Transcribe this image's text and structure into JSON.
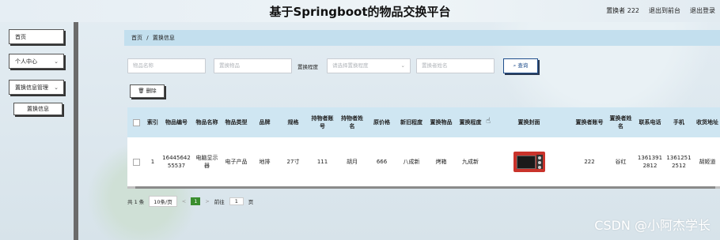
{
  "header": {
    "title": "基于Springboot的物品交换平台",
    "user": "置换者 222",
    "back_to_front": "退出到前台",
    "logout": "退出登录"
  },
  "sidebar": {
    "items": [
      {
        "label": "首页"
      },
      {
        "label": "个人中心"
      },
      {
        "label": "置换信息管理"
      }
    ],
    "sub_item": "置换信息"
  },
  "breadcrumb": {
    "home": "首页",
    "sep": "/",
    "current": "置换信息"
  },
  "filters": {
    "item_name_placeholder": "物品名称",
    "exchange_item_placeholder": "置换物品",
    "exchange_degree_label": "置换程度",
    "exchange_degree_placeholder": "请选择置换程度",
    "exchanger_name_placeholder": "置换者姓名",
    "query_label": "查询"
  },
  "delete_label": "删除",
  "table": {
    "headers": {
      "index": "索引",
      "item_no": "物品编号",
      "item_name": "物品名称",
      "item_type": "物品类型",
      "brand": "品牌",
      "spec": "规格",
      "holder_account": "持物者账号",
      "holder_name": "持物者姓名",
      "original_price": "原价格",
      "condition": "新旧程度",
      "exchange_item": "置换物品",
      "exchange_degree": "置换程度",
      "cover": "置换封面",
      "exchanger_account": "置换者账号",
      "exchanger_name": "置换者姓名",
      "contact_phone": "联系电话",
      "mobile": "手机",
      "address": "收货地址"
    },
    "row": {
      "index": "1",
      "item_no": "1644564255537",
      "item_name": "电脑显示器",
      "item_type": "电子产品",
      "brand": "地排",
      "spec": "27寸",
      "holder_account": "111",
      "holder_name": "胡月",
      "original_price": "666",
      "condition": "八成新",
      "exchange_item": "烤箱",
      "exchange_degree": "九成新",
      "exchanger_account": "222",
      "exchanger_name": "谷红",
      "contact_phone": "13613912812",
      "mobile": "13612512512",
      "address": "胡姬道"
    }
  },
  "pager": {
    "total": "共 1 条",
    "page_size": "10条/页",
    "prev": "<",
    "current": "1",
    "next": ">",
    "goto_label": "前往",
    "goto_value": "1",
    "page_suffix": "页"
  },
  "watermark": "CSDN @小阿杰学长",
  "colors": {
    "breadcrumb_bg": "#c3dfee",
    "table_header_bg": "#cfe6f2",
    "pager_active": "#3a8e2e",
    "query_accent": "#1f4e8c"
  },
  "icons": [
    "trash-icon",
    "search-icon",
    "chevron-down-icon",
    "pointer-cursor-icon"
  ]
}
